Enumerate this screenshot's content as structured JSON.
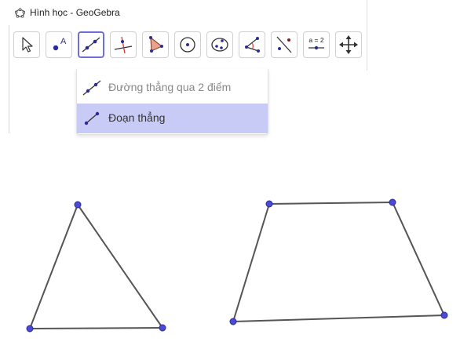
{
  "window": {
    "title": "Hình học - GeoGebra"
  },
  "toolbar": {
    "tools": [
      {
        "name": "move",
        "icon": "cursor-arrow-icon"
      },
      {
        "name": "point",
        "icon": "point-icon",
        "label": "A"
      },
      {
        "name": "line",
        "icon": "line-through-points-icon",
        "active": true
      },
      {
        "name": "perpendicular",
        "icon": "perpendicular-line-icon"
      },
      {
        "name": "polygon",
        "icon": "polygon-icon"
      },
      {
        "name": "circle",
        "icon": "circle-center-point-icon"
      },
      {
        "name": "ellipse",
        "icon": "ellipse-icon"
      },
      {
        "name": "angle",
        "icon": "angle-icon"
      },
      {
        "name": "reflect",
        "icon": "reflect-about-line-icon"
      },
      {
        "name": "slider",
        "icon": "slider-icon",
        "label": "a = 2"
      },
      {
        "name": "move-graphics",
        "icon": "move-graphics-view-icon"
      }
    ]
  },
  "dropdown": {
    "items": [
      {
        "label": "Đường thẳng qua 2 điểm",
        "icon": "line-through-two-points-icon"
      },
      {
        "label": "Đoạn thẳng",
        "icon": "segment-icon",
        "selected": true
      }
    ]
  },
  "colors": {
    "accent": "#6f6fd8",
    "selected_item": "#c9cbf7",
    "point": "#4a4ad4",
    "line": "#555555"
  }
}
